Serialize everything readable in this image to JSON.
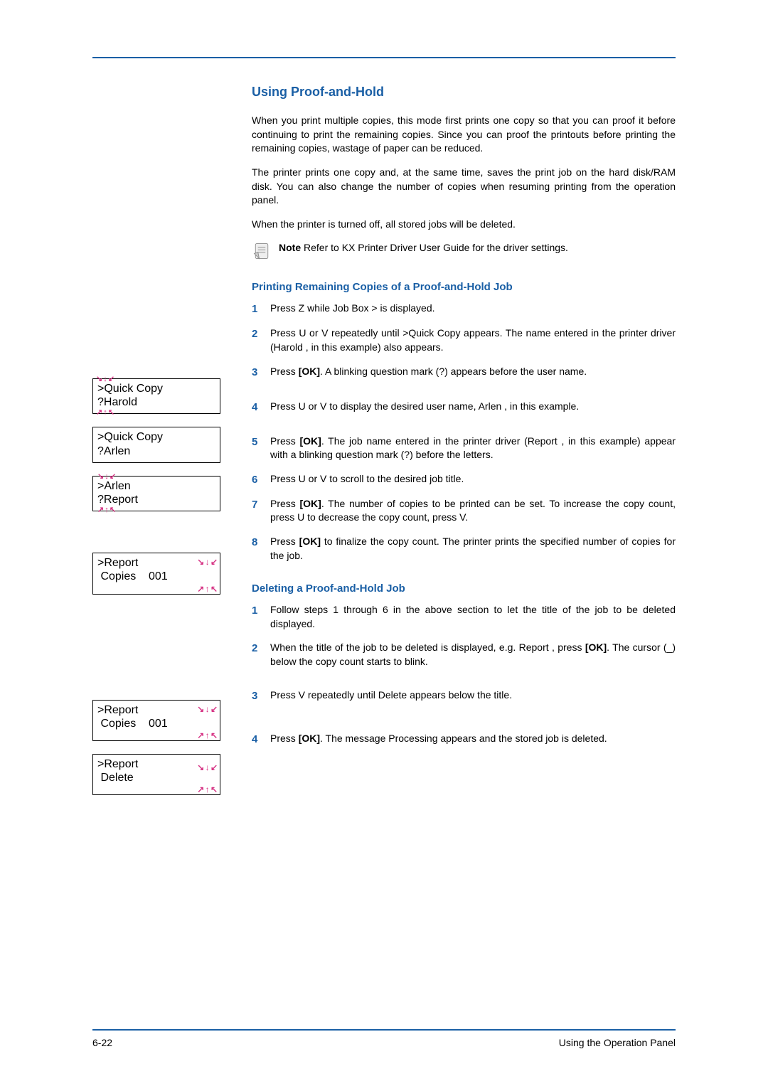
{
  "header": {
    "section_title": "Using Proof-and-Hold"
  },
  "intro": {
    "p1": "When you print multiple copies, this mode first prints one copy so that you can proof it before continuing to print the remaining copies. Since you can proof the printouts before printing the remaining copies, wastage of paper can be reduced.",
    "p2": "The printer prints one copy and, at the same time, saves the print job on the hard disk/RAM disk. You can also change the number of copies when resuming printing from the operation panel.",
    "p3": "When the printer is turned off, all stored jobs will be deleted.",
    "note_label": "Note",
    "note_text": "  Refer to KX Printer Driver User Guide for the driver settings."
  },
  "printing": {
    "title": "Printing Remaining Copies of a Proof-and-Hold Job",
    "steps": {
      "s1": "Press  Z while Job Box >  is displayed.",
      "s2": "Press  U or  V repeatedly until >Quick Copy  appears. The name entered in the printer driver (Harold , in this example) also appears.",
      "s3_a": "Press ",
      "s3_b": "[OK]",
      "s3_c": ". A blinking question mark (?) appears before the user name.",
      "s4": "Press  U or  V to display the desired user name, Arlen , in this example.",
      "s5_a": "Press ",
      "s5_b": "[OK]",
      "s5_c": ". The job name entered in the printer driver (Report , in this example) appear with a blinking question mark (?) before the letters.",
      "s6": "Press  U or  V to scroll to the desired job title.",
      "s7_a": "Press ",
      "s7_b": "[OK]",
      "s7_c": ". The number of copies to be printed can be set. To increase the copy count, press  U to decrease the copy count, press  V.",
      "s8_a": "Press ",
      "s8_b": "[OK]",
      "s8_c": " to finalize the copy count. The printer prints the specified number of copies for the job."
    }
  },
  "deleting": {
    "title": "Deleting a Proof-and-Hold Job",
    "steps": {
      "s1": "Follow steps 1 through 6 in the above section to let the title of the job to be deleted displayed.",
      "s2_a": "When the title of the job to be deleted is displayed, e.g. Report , press ",
      "s2_b": "[OK]",
      "s2_c": ". The cursor (_) below the copy count starts to blink.",
      "s3": "Press  V repeatedly until Delete  appears below the title.",
      "s4_a": "Press ",
      "s4_b": "[OK]",
      "s4_c": ". The message Processing   appears and the stored job is deleted."
    }
  },
  "lcd": {
    "box1_l1": ">Quick Copy",
    "box1_l2": "?Harold",
    "box2_l1": ">Quick Copy",
    "box2_l2": "?Arlen",
    "box3_l1": ">Arlen",
    "box3_l2": "?Report",
    "box4_l1": ">Report",
    "box4_l2": " Copies    001",
    "box5_l1": ">Report",
    "box5_l2": " Copies    001",
    "box6_l1": ">Report",
    "box6_l2": " Delete"
  },
  "footer": {
    "page_num": "6-22",
    "section_name": "Using the Operation Panel"
  }
}
